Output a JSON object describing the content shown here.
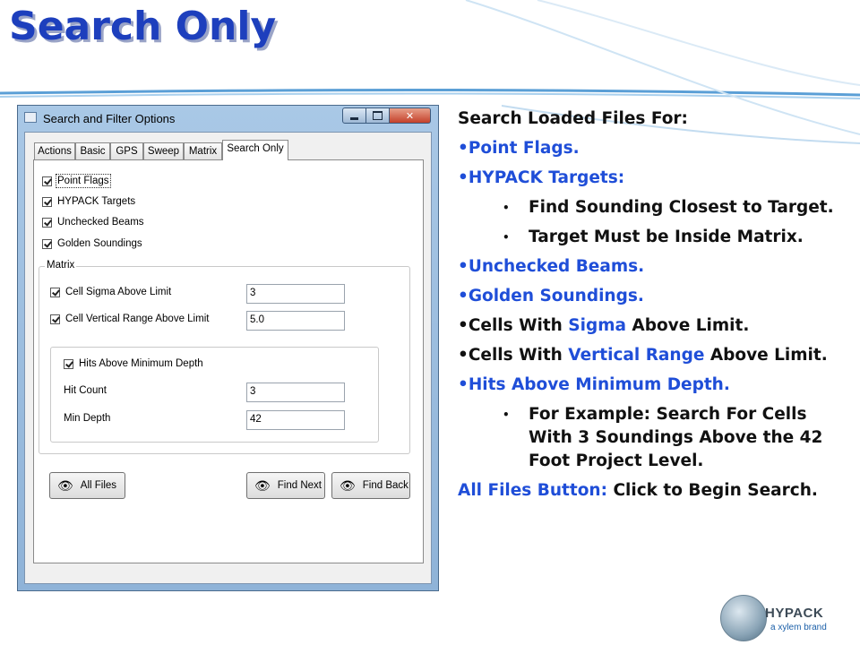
{
  "slide": {
    "title": "Search Only"
  },
  "window": {
    "title": "Search and Filter Options",
    "close_glyph": "✕",
    "tabs": [
      {
        "label": "Actions"
      },
      {
        "label": "Basic"
      },
      {
        "label": "GPS"
      },
      {
        "label": "Sweep"
      },
      {
        "label": "Matrix"
      },
      {
        "label": "Search Only",
        "active": true
      }
    ],
    "checks": {
      "point_flags": {
        "label": "Point Flags",
        "checked": true
      },
      "hypack_targets": {
        "label": "HYPACK Targets",
        "checked": true
      },
      "unchecked_beams": {
        "label": "Unchecked Beams",
        "checked": true
      },
      "golden_soundings": {
        "label": "Golden Soundings",
        "checked": true
      }
    },
    "matrix": {
      "label": "Matrix",
      "cell_sigma": {
        "label": "Cell Sigma Above Limit",
        "checked": true,
        "value": "3"
      },
      "cell_vertical": {
        "label": "Cell Vertical Range Above Limit",
        "checked": true,
        "value": "5.0"
      },
      "hits": {
        "label": "Hits Above Minimum Depth",
        "checked": true
      },
      "hit_count": {
        "label": "Hit Count",
        "value": "3"
      },
      "min_depth": {
        "label": "Min Depth",
        "value": "42"
      }
    },
    "buttons": {
      "all_files": "All Files",
      "find_next": "Find Next",
      "find_back": "Find Back"
    }
  },
  "notes": {
    "heading": "Search Loaded Files For:",
    "point_flags": "•Point Flags.",
    "hypack_targets": "•HYPACK Targets:",
    "sub1": "Find Sounding Closest to Target.",
    "sub2": "Target Must be Inside Matrix.",
    "unchecked": "•Unchecked Beams.",
    "golden": "•Golden Soundings.",
    "cells_sigma_pre": "•Cells With ",
    "cells_sigma_blue": "Sigma",
    "cells_sigma_post": " Above Limit.",
    "cells_vr_pre": "•Cells With ",
    "cells_vr_blue": "Vertical Range",
    "cells_vr_post": " Above Limit.",
    "hits": "•Hits Above Minimum Depth.",
    "sub3": "For Example:  Search For Cells With 3 Soundings Above the 42 Foot Project Level.",
    "all_files_pre": "All Files Button:",
    "all_files_post": "  Click to Begin Search.",
    "bullet": "•"
  },
  "logo": {
    "name": "HYPACK",
    "tagline": "a xylem brand"
  },
  "colors": {
    "title": "#1d3fbd",
    "accent_blue": "#1f4ed8"
  }
}
